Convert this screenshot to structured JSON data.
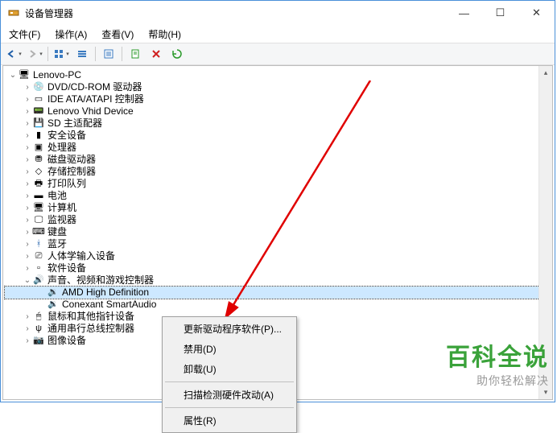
{
  "window": {
    "title": "设备管理器"
  },
  "menubar": {
    "file": "文件(F)",
    "action": "操作(A)",
    "view": "查看(V)",
    "help": "帮助(H)"
  },
  "toolbar_icons": {
    "back": "⬅",
    "back_name": "back-icon",
    "forward": "➡",
    "forward_name": "forward-icon",
    "up": "⇧",
    "view1": "▥",
    "view2": "▤",
    "props": "☰",
    "refresh": "↻",
    "delete": "✖",
    "scan": "⟳"
  },
  "tree": {
    "root": "Lenovo-PC",
    "items": [
      {
        "label": "DVD/CD-ROM 驱动器",
        "icon": "💿",
        "name": "dvd-cdrom"
      },
      {
        "label": "IDE ATA/ATAPI 控制器",
        "icon": "▭",
        "name": "ide-ata"
      },
      {
        "label": "Lenovo Vhid Device",
        "icon": "📟",
        "name": "lenovo-vhid"
      },
      {
        "label": "SD 主适配器",
        "icon": "💾",
        "name": "sd-adapter"
      },
      {
        "label": "安全设备",
        "icon": "▮",
        "name": "security-devices"
      },
      {
        "label": "处理器",
        "icon": "▣",
        "name": "processors"
      },
      {
        "label": "磁盘驱动器",
        "icon": "⛃",
        "name": "disk-drives"
      },
      {
        "label": "存储控制器",
        "icon": "◇",
        "name": "storage-controllers"
      },
      {
        "label": "打印队列",
        "icon": "🖶",
        "name": "print-queues"
      },
      {
        "label": "电池",
        "icon": "▬",
        "name": "batteries"
      },
      {
        "label": "计算机",
        "icon": "🖥",
        "name": "computer"
      },
      {
        "label": "监视器",
        "icon": "🖵",
        "name": "monitors"
      },
      {
        "label": "键盘",
        "icon": "⌨",
        "name": "keyboards"
      },
      {
        "label": "蓝牙",
        "icon": "ᚼ",
        "name": "bluetooth"
      },
      {
        "label": "人体学输入设备",
        "icon": "⎚",
        "name": "hid-devices"
      },
      {
        "label": "软件设备",
        "icon": "▫",
        "name": "software-devices"
      }
    ],
    "audio": {
      "label": "声音、视频和游戏控制器",
      "icon": "🔊",
      "children": [
        {
          "label": "AMD High Definition",
          "icon": "🔉",
          "name": "amd-hd-audio"
        },
        {
          "label": "Conexant SmartAudio",
          "icon": "🔉",
          "name": "conexant-audio"
        }
      ]
    },
    "tail": [
      {
        "label": "鼠标和其他指针设备",
        "icon": "🖱",
        "name": "mice-pointing"
      },
      {
        "label": "通用串行总线控制器",
        "icon": "ψ",
        "name": "usb-controllers"
      },
      {
        "label": "图像设备",
        "icon": "📷",
        "name": "imaging-devices"
      }
    ]
  },
  "context_menu": {
    "update": "更新驱动程序软件(P)...",
    "disable": "禁用(D)",
    "uninstall": "卸载(U)",
    "scanchanges": "扫描检测硬件改动(A)",
    "properties": "属性(R)"
  },
  "watermark": {
    "big": "百科全说",
    "small": "助你轻松解决"
  }
}
